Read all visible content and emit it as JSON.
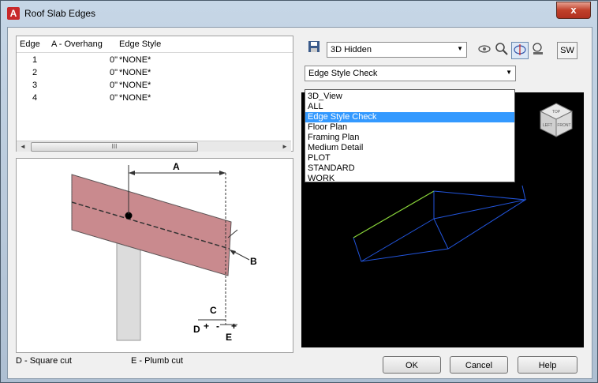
{
  "window": {
    "title": "Roof Slab Edges",
    "close_symbol": "x"
  },
  "edge_table": {
    "headers": [
      "Edge",
      "A - Overhang",
      "Edge Style"
    ],
    "rows": [
      {
        "edge": "1",
        "overhang": "0\"",
        "style": "*NONE*"
      },
      {
        "edge": "2",
        "overhang": "0\"",
        "style": "*NONE*"
      },
      {
        "edge": "3",
        "overhang": "0\"",
        "style": "*NONE*"
      },
      {
        "edge": "4",
        "overhang": "0\"",
        "style": "*NONE*"
      }
    ],
    "scroll_left": "◄",
    "scroll_right": "►",
    "scroll_thumb": "III"
  },
  "diagram": {
    "labels": {
      "a": "A",
      "b": "B",
      "c": "C",
      "d": "D",
      "e": "E",
      "plus": "+",
      "minus": "-"
    }
  },
  "legend": {
    "square_cut": "D - Square cut",
    "plumb_cut": "E - Plumb cut"
  },
  "toolbar": {
    "visual_style": "3D Hidden",
    "view_direction": "SW"
  },
  "edge_style_dropdown": {
    "selected": "Edge Style Check",
    "options": [
      "3D_View",
      "ALL",
      "Edge Style Check",
      "Floor Plan",
      "Framing Plan",
      "Medium Detail",
      "PLOT",
      "STANDARD",
      "WORK"
    ]
  },
  "view_cube": {
    "top": "TOP",
    "left": "LEFT",
    "front": "FRONT"
  },
  "buttons": {
    "ok": "OK",
    "cancel": "Cancel",
    "help": "Help"
  },
  "colors": {
    "viewport_bg": "#000000",
    "wire_blue": "#2255dd",
    "wire_green": "#8ad63a",
    "selection": "#3399ff",
    "slab_fill": "#c98a8e"
  }
}
